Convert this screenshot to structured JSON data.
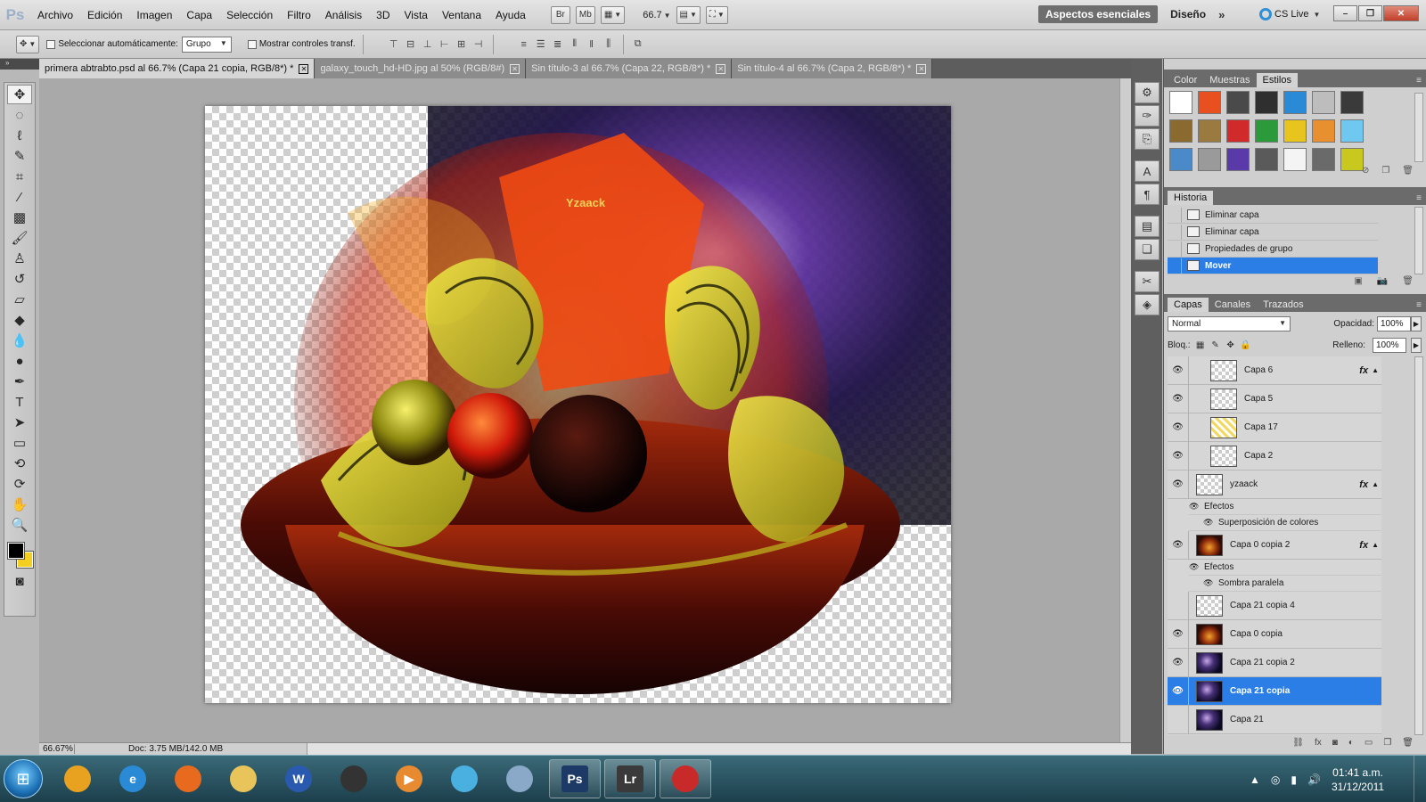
{
  "app": {
    "logo": "Ps",
    "menu": [
      "Archivo",
      "Edición",
      "Imagen",
      "Capa",
      "Selección",
      "Filtro",
      "Análisis",
      "3D",
      "Vista",
      "Ventana",
      "Ayuda"
    ],
    "appbar": {
      "bridge": "Br",
      "minibridge": "Mb",
      "zoom": "66.7"
    },
    "workspace": {
      "active": "Aspectos esenciales",
      "other": "Diseño",
      "more": "»"
    },
    "cslive": "CS Live",
    "window_controls": {
      "minimize": "–",
      "restore": "❐",
      "close": "✕"
    }
  },
  "options": {
    "auto_select_label": "Seleccionar automáticamente:",
    "auto_select_value": "Grupo",
    "show_transform_label": "Mostrar controles transf."
  },
  "tabs": [
    {
      "label": "primera abtrabto.psd al 66.7% (Capa 21 copia, RGB/8*) *",
      "active": true
    },
    {
      "label": "galaxy_touch_hd-HD.jpg al 50% (RGB/8#)",
      "active": false
    },
    {
      "label": "Sin título-3 al 66.7% (Capa 22, RGB/8*) *",
      "active": false
    },
    {
      "label": "Sin título-4 al 66.7% (Capa 2, RGB/8*) *",
      "active": false
    }
  ],
  "artwork": {
    "signature": "Yzaack"
  },
  "status": {
    "zoom": "66.67%",
    "doc": "Doc: 3.75 MB/142.0 MB"
  },
  "style_panel": {
    "tabs": [
      "Color",
      "Muestras",
      "Estilos"
    ],
    "active_tab": "Estilos",
    "swatches": [
      "#ffffff",
      "#e8501f",
      "#4a4a4a",
      "#2f2f2f",
      "#2a8ad6",
      "#bdbdbd",
      "#3a3a3a",
      "#8a6a2f",
      "#9a7a3f",
      "#d02a2a",
      "#2a9a3a",
      "#e8c41f",
      "#e8902f",
      "#6ec8ef",
      "#4a8ac8",
      "#9a9a9a",
      "#5a3aa8",
      "#5a5a5a",
      "#f4f4f4",
      "#6a6a6a",
      "#c8c81f"
    ]
  },
  "history": {
    "title": "Historia",
    "items": [
      "Eliminar capa",
      "Eliminar capa",
      "Propiedades de grupo",
      "Mover"
    ],
    "active_index": 3
  },
  "layers_panel": {
    "tabs": [
      "Capas",
      "Canales",
      "Trazados"
    ],
    "blend_mode": "Normal",
    "opacity_label": "Opacidad:",
    "opacity": "100%",
    "lock_label": "Bloq.:",
    "fill_label": "Relleno:",
    "fill": "100%",
    "effects_label": "Efectos",
    "layers": [
      {
        "name": "Capa 6",
        "visible": true,
        "fx": "fx",
        "thumb": "checker",
        "indent": true
      },
      {
        "name": "Capa 5",
        "visible": true,
        "fx": "",
        "thumb": "checker",
        "indent": true
      },
      {
        "name": "Capa 17",
        "visible": true,
        "fx": "",
        "thumb": "yellow",
        "indent": true
      },
      {
        "name": "Capa 2",
        "visible": true,
        "fx": "",
        "thumb": "checker",
        "indent": true
      },
      {
        "name": "yzaack",
        "visible": true,
        "fx": "fx",
        "thumb": "checker",
        "indent": false,
        "effects": [
          "Superposición de colores"
        ]
      },
      {
        "name": "Capa 0 copia 2",
        "visible": true,
        "fx": "fx",
        "thumb": "art",
        "indent": false,
        "effects": [
          "Sombra paralela"
        ]
      },
      {
        "name": "Capa 21 copia 4",
        "visible": false,
        "fx": "",
        "thumb": "checker",
        "indent": false
      },
      {
        "name": "Capa 0 copia",
        "visible": true,
        "fx": "",
        "thumb": "art",
        "indent": false
      },
      {
        "name": "Capa 21 copia 2",
        "visible": true,
        "fx": "",
        "thumb": "space",
        "indent": false
      },
      {
        "name": "Capa 21 copia",
        "visible": true,
        "fx": "",
        "thumb": "space",
        "indent": false,
        "selected": true
      },
      {
        "name": "Capa 21",
        "visible": false,
        "fx": "",
        "thumb": "space",
        "indent": false
      }
    ]
  },
  "taskbar": {
    "apps": [
      {
        "name": "chrome",
        "label": "",
        "color": "#e8a21f"
      },
      {
        "name": "internet-explorer",
        "label": "e",
        "color": "#2a8ad6"
      },
      {
        "name": "firefox",
        "label": "",
        "color": "#e86a1f"
      },
      {
        "name": "explorer",
        "label": "",
        "color": "#e8c45a"
      },
      {
        "name": "word",
        "label": "W",
        "color": "#2a5ab0"
      },
      {
        "name": "media",
        "label": "",
        "color": "#333333"
      },
      {
        "name": "video",
        "label": "▶",
        "color": "#e88a2f"
      },
      {
        "name": "messenger",
        "label": "",
        "color": "#4ab0e0"
      },
      {
        "name": "calculator",
        "label": "",
        "color": "#8aa8c8"
      },
      {
        "name": "photoshop",
        "label": "Ps",
        "color": "#1d3a66",
        "running": true
      },
      {
        "name": "lightroom",
        "label": "Lr",
        "color": "#3a3a3a",
        "running": true
      },
      {
        "name": "acrobat",
        "label": "",
        "color": "#c82a2a",
        "running": true
      }
    ],
    "time": "01:41 a.m.",
    "date": "31/12/2011"
  },
  "colors": {
    "accent": "#2b7ee6",
    "fg": "#000000",
    "bg": "#f5cf1f"
  }
}
